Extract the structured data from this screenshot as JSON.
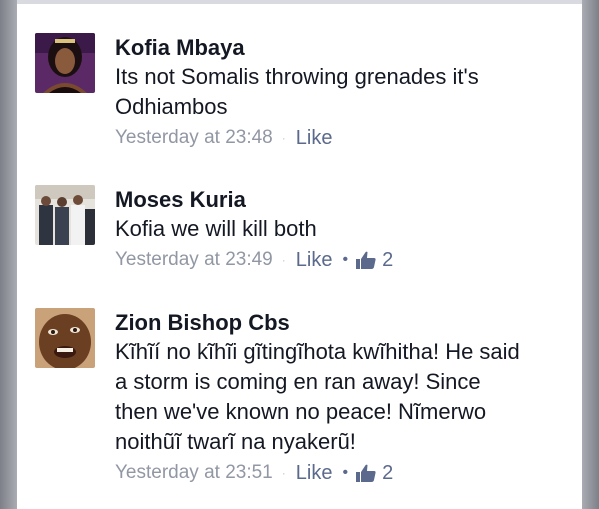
{
  "comments": [
    {
      "author": "Kofia Mbaya",
      "text": "Its not Somalis throwing grenades it's\nOdhiambos",
      "timestamp": "Yesterday at 23:48",
      "like_label": "Like",
      "like_count": ""
    },
    {
      "author": "Moses Kuria",
      "text": "Kofia we will kill both",
      "timestamp": "Yesterday at 23:49",
      "like_label": "Like",
      "like_count": "2"
    },
    {
      "author": "Zion Bishop Cbs",
      "text": "Kĩhĩí no kĩhĩi gĩtingĩhota kwĩhitha! He said\na storm is coming en ran away! Since\nthen we've known no peace! Nĩmerwo\nnoithũĩ twarĩ na nyakerũ!",
      "timestamp": "Yesterday at 23:51",
      "like_label": "Like",
      "like_count": "2"
    }
  ],
  "icons": {
    "separator": "·",
    "like_dot": "•",
    "thumb": "thumbs-up-icon"
  },
  "colors": {
    "name": "#141823",
    "meta": "#9197a3",
    "link": "#5b6a8c"
  }
}
